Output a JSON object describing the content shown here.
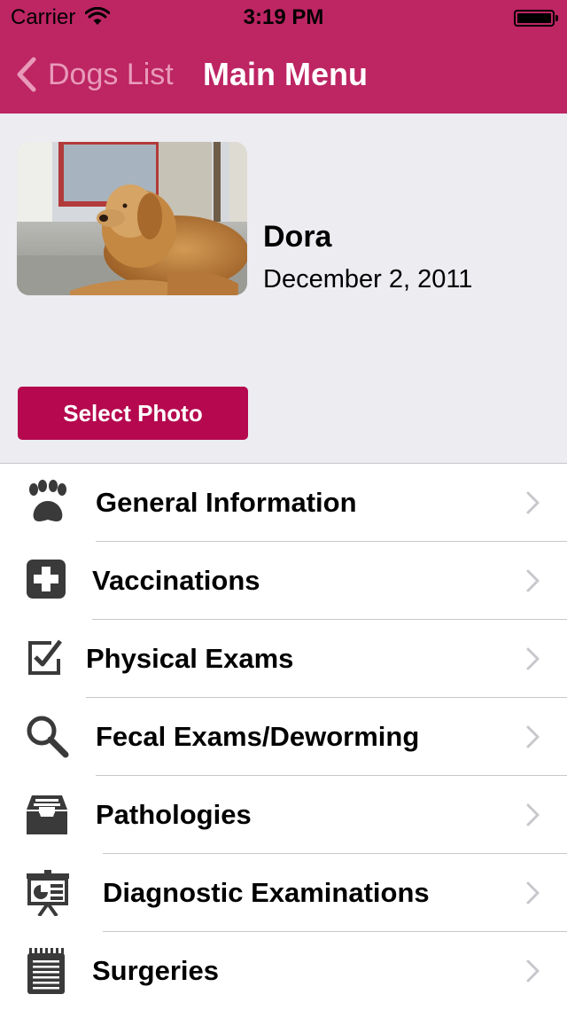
{
  "status_bar": {
    "carrier": "Carrier",
    "time": "3:19 PM"
  },
  "nav": {
    "back_label": "Dogs List",
    "title": "Main Menu"
  },
  "dog": {
    "name": "Dora",
    "date": "December 2, 2011"
  },
  "buttons": {
    "select_photo": "Select Photo"
  },
  "colors": {
    "brand": "#bd2563",
    "button": "#b5084e",
    "back_text": "#e89ab9",
    "header_bg": "#ececf1"
  },
  "menu": [
    {
      "label": "General Information",
      "icon": "paw-icon"
    },
    {
      "label": "Vaccinations",
      "icon": "medical-cross-icon"
    },
    {
      "label": "Physical Exams",
      "icon": "checkbox-icon"
    },
    {
      "label": "Fecal Exams/Deworming",
      "icon": "magnifier-icon"
    },
    {
      "label": "Pathologies",
      "icon": "inbox-tray-icon"
    },
    {
      "label": "Diagnostic Examinations",
      "icon": "presentation-board-icon"
    },
    {
      "label": "Surgeries",
      "icon": "notepad-icon"
    }
  ]
}
